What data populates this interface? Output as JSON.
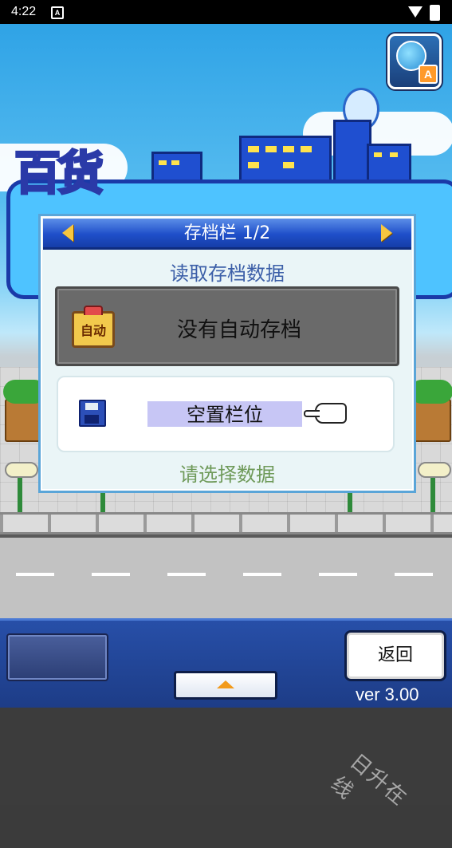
{
  "status_bar": {
    "time": "4:22",
    "notification_icon": "A"
  },
  "game": {
    "language_button": {
      "icon": "globe-translate-icon",
      "badge": "A"
    },
    "dialog": {
      "title": "存档栏 1/2",
      "subtitle": "读取存档数据",
      "slots": [
        {
          "icon_text": "自动",
          "label": "没有自动存档",
          "state": "disabled"
        },
        {
          "label": "空置栏位",
          "state": "selected"
        }
      ],
      "hint": "请选择数据"
    },
    "bottom_bar": {
      "back_label": "返回",
      "version": "ver 3.00"
    },
    "watermark": "日升在线"
  },
  "colors": {
    "header_blue": "#1f4fc9",
    "dialog_bg": "#eaf5f7",
    "panel_blue": "#274fa8",
    "selection": "#c7c6f5"
  }
}
